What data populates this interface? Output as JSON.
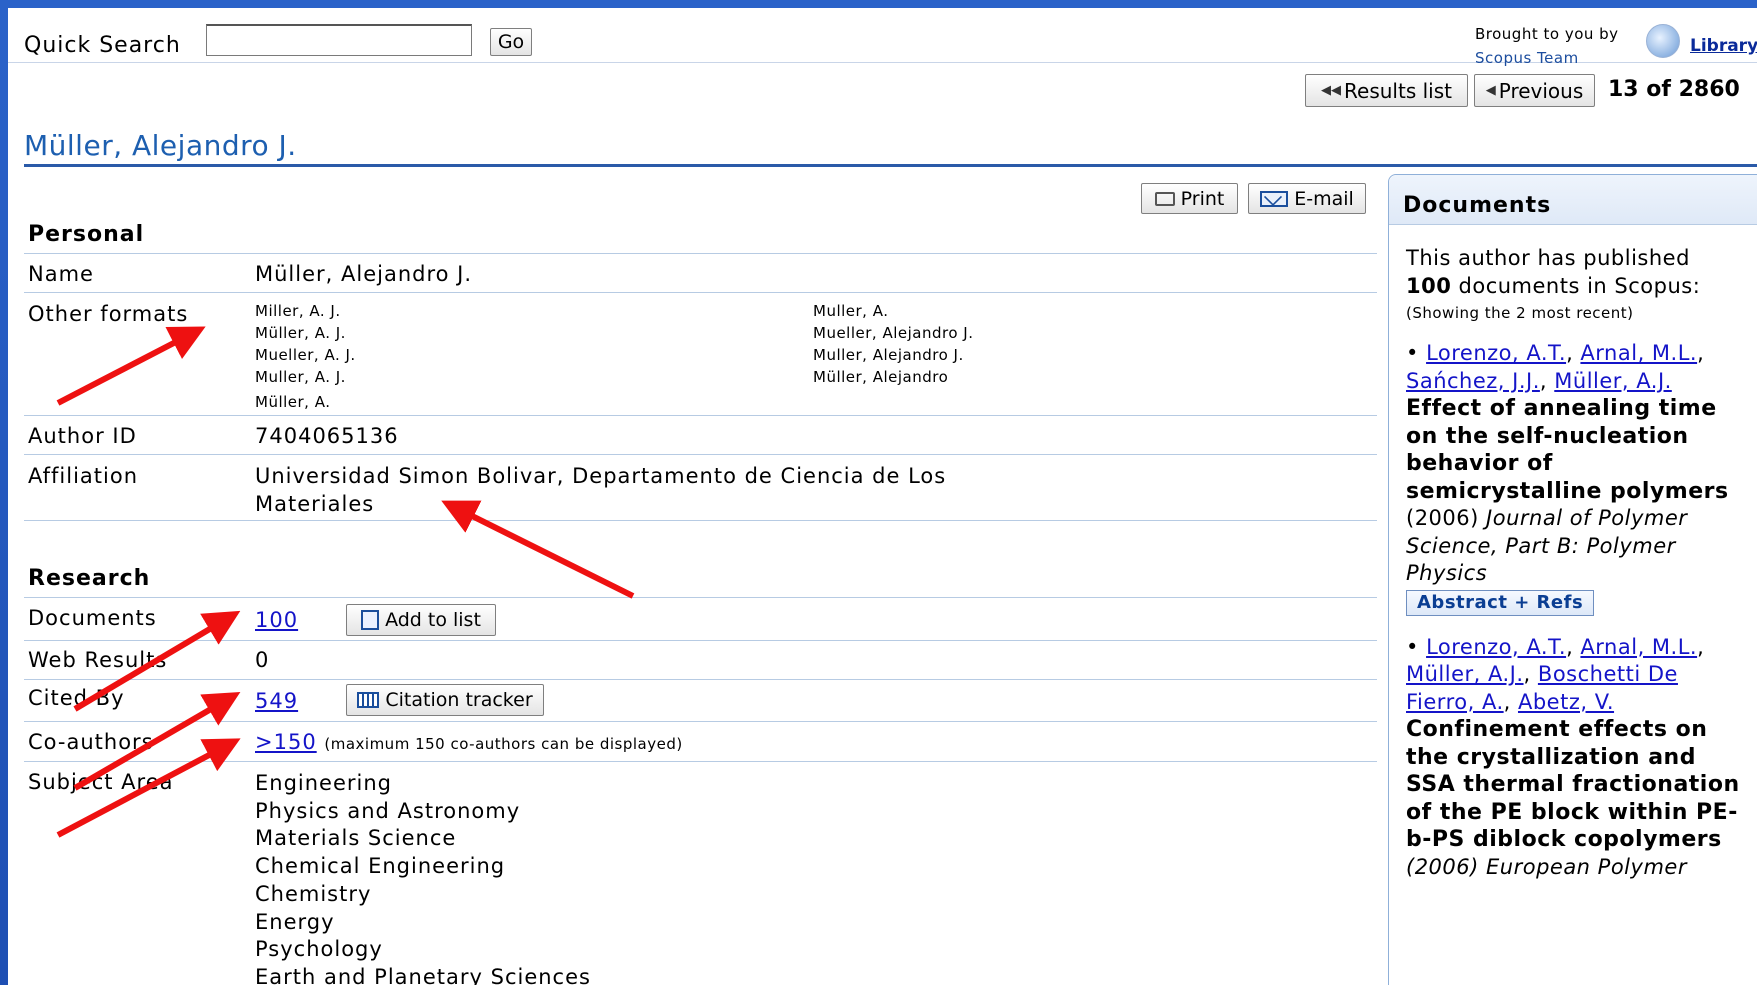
{
  "topbar": {
    "quick_search_label": "Quick Search",
    "search_value": "",
    "go_label": "Go",
    "brought_by_line1": "Brought to you by",
    "brought_by_line2": "Scopus Team",
    "library_link": "Library"
  },
  "nav": {
    "results_list_label": "Results list",
    "previous_label": "Previous",
    "position_text": "13 of 2860"
  },
  "author": {
    "name_title": "Müller, Alejandro J."
  },
  "actions": {
    "print_label": "Print",
    "email_label": "E-mail"
  },
  "personal": {
    "section_title": "Personal",
    "name_label": "Name",
    "name_value": "Müller, Alejandro J.",
    "other_formats_label": "Other formats",
    "other_formats_col1": [
      "Miller, A. J.",
      "Müller, A. J.",
      "Mueller, A. J.",
      "Muller, A. J.",
      "Müller, A."
    ],
    "other_formats_col2": [
      "Muller, A.",
      "Mueller, Alejandro J.",
      "Muller, Alejandro J.",
      "Müller, Alejandro"
    ],
    "author_id_label": "Author ID",
    "author_id_value": "7404065136",
    "affiliation_label": "Affiliation",
    "affiliation_line1": "Universidad Simon Bolivar, Departamento de Ciencia de Los",
    "affiliation_line2": "Materiales"
  },
  "research": {
    "section_title": "Research",
    "documents_label": "Documents",
    "documents_value": "100",
    "add_to_list_label": "Add to list",
    "web_results_label": "Web Results",
    "web_results_value": "0",
    "cited_by_label": "Cited By",
    "cited_by_value": "549",
    "citation_tracker_label": "Citation tracker",
    "coauthors_label": "Co-authors",
    "coauthors_value": ">150",
    "coauthors_note": "(maximum 150 co-authors can be displayed)",
    "subject_area_label": "Subject Area",
    "subject_areas": [
      "Engineering",
      "Physics and Astronomy",
      "Materials Science",
      "Chemical Engineering",
      "Chemistry",
      "Energy",
      "Psychology",
      "Earth and Planetary Sciences"
    ]
  },
  "documents_panel": {
    "title": "Documents",
    "intro_line1": "This author has published",
    "intro_count": "100",
    "intro_line2_rest": " documents in Scopus:",
    "showing_text": "(Showing the 2 most recent)",
    "doc1": {
      "authors": [
        "Lorenzo, A.T.",
        "Arnal, M.L.",
        "Sańchez, J.J.",
        "Müller, A.J."
      ],
      "title": "Effect of annealing time on the self-nucleation behavior of semicrystalline polymers",
      "year": "(2006)",
      "journal": "Journal of Polymer Science, Part B: Polymer Physics",
      "abstract_button": "Abstract + Refs"
    },
    "doc2": {
      "authors": [
        "Lorenzo, A.T.",
        "Arnal, M.L.",
        "Müller, A.J.",
        "Boschetti De Fierro, A.",
        "Abetz, V."
      ],
      "title": "Confinement effects on the crystallization and SSA thermal fractionation of the PE block within PE-b-PS diblock copolymers",
      "year_journal_partial": "(2006) European Polymer"
    }
  },
  "colors": {
    "accent_blue": "#1d5fb0",
    "link": "#1414c8",
    "arrow_red": "#ee1111",
    "background": "#1e4fb3"
  }
}
